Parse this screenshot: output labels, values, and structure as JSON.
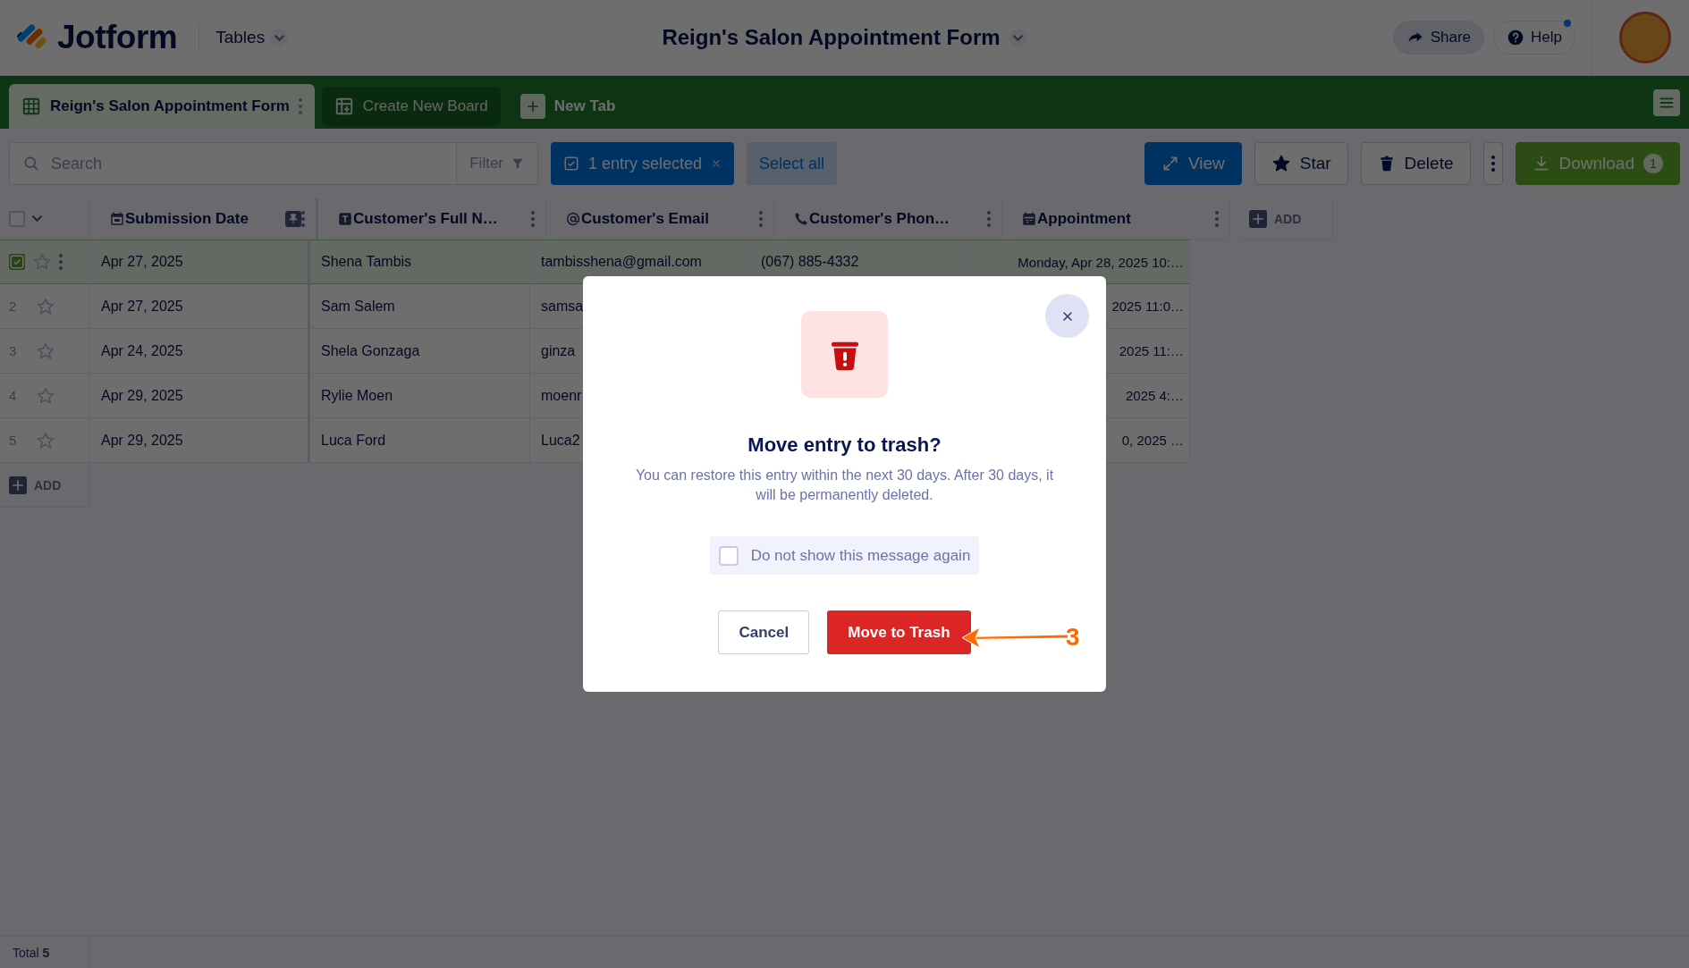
{
  "header": {
    "logo": "Jotform",
    "menu": "Tables",
    "title": "Reign's Salon Appointment Form",
    "buttons": [
      {
        "kind": "share",
        "label": "Share",
        "notification": false
      },
      {
        "kind": "help",
        "label": "Help",
        "notification": true
      }
    ]
  },
  "tabs": [
    {
      "kind": "table",
      "label": "Reign's Salon Appointment Form",
      "selected": true
    },
    {
      "kind": "board",
      "label": "Create New Board",
      "selected": false
    },
    {
      "kind": "add",
      "label": "New Tab",
      "selected": false
    }
  ],
  "toolbar": {
    "search": {
      "placeholder": "Search"
    },
    "filter": "Filter",
    "selection": "1 entry selected",
    "select_all": "Select all",
    "actions": [
      {
        "kind": "view",
        "label": "View"
      },
      {
        "kind": "star",
        "label": "Star"
      },
      {
        "kind": "delete",
        "label": "Delete"
      },
      {
        "kind": "more"
      },
      {
        "kind": "download",
        "label": "Download",
        "badge": "1"
      }
    ]
  },
  "table": {
    "columns": [
      {
        "kind": "date",
        "label": "Submission Date",
        "pinned": true
      },
      {
        "kind": "text",
        "label": "Customer's Full N…",
        "pinned": false
      },
      {
        "kind": "email",
        "label": "Customer's Email",
        "pinned": false
      },
      {
        "kind": "phone",
        "label": "Customer's Phon…",
        "pinned": false
      },
      {
        "kind": "appointment",
        "label": "Appointment",
        "pinned": false
      }
    ],
    "add_column": "ADD",
    "all_selected": false,
    "rows": [
      {
        "selected": true,
        "starred": false,
        "cells": [
          "Apr 27, 2025",
          "Shena Tambis",
          "tambisshena@gmail.com",
          "(067) 885-4332",
          "Monday, Apr 28, 2025 10:…"
        ]
      },
      {
        "number": "2",
        "selected": false,
        "starred": false,
        "cells": [
          "Apr 27, 2025",
          "Sam Salem",
          "samsa",
          "",
          "2025 11:0…"
        ]
      },
      {
        "number": "3",
        "selected": false,
        "starred": false,
        "cells": [
          "Apr 24, 2025",
          "Shela Gonzaga",
          "ginza",
          "",
          "2025 11:…"
        ]
      },
      {
        "number": "4",
        "selected": false,
        "starred": false,
        "cells": [
          "Apr 29, 2025",
          "Rylie Moen",
          "moenr",
          "",
          "2025 4:…"
        ]
      },
      {
        "number": "5",
        "selected": false,
        "starred": false,
        "cells": [
          "Apr 29, 2025",
          "Luca Ford",
          "Luca2",
          "",
          "0, 2025 …"
        ]
      }
    ],
    "add_row": "ADD"
  },
  "status_bar": {
    "total": "Total **5**"
  },
  "dialog": {
    "title": "Move entry to trash?",
    "message": "You can restore this entry within the next 30 days. After 30 days, it will be permanently deleted.",
    "checkbox": {
      "label": "Do not show this message again",
      "checked": false
    },
    "buttons": [
      {
        "kind": "secondary",
        "label": "Cancel"
      },
      {
        "kind": "danger",
        "label": "Move to Trash"
      }
    ]
  },
  "annotation": {
    "label": "3"
  }
}
